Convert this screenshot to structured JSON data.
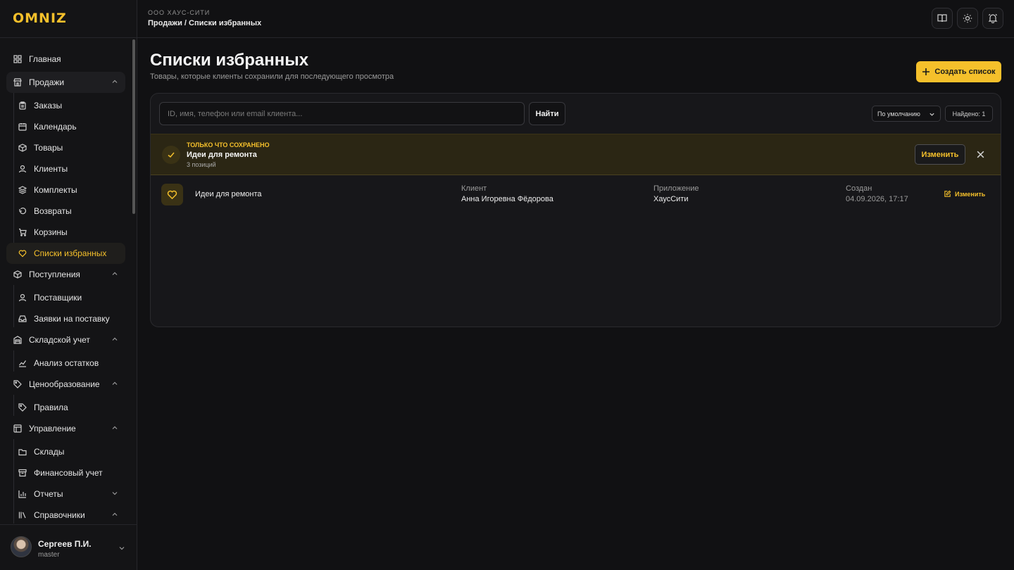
{
  "brand": {
    "logo_text": "OMNIZ",
    "accent": "#f5c02b"
  },
  "header": {
    "org": "ООО ХАУС-СИТИ",
    "breadcrumb": "Продажи / Списки избранных"
  },
  "sidebar": {
    "items": [
      {
        "label": "Главная",
        "icon": "grid-icon"
      },
      {
        "label": "Продажи",
        "icon": "store-icon",
        "expanded": true
      },
      {
        "label": "Заказы",
        "icon": "clipboard-icon"
      },
      {
        "label": "Календарь",
        "icon": "calendar-icon"
      },
      {
        "label": "Товары",
        "icon": "box-icon"
      },
      {
        "label": "Клиенты",
        "icon": "user-icon"
      },
      {
        "label": "Комплекты",
        "icon": "layers-icon"
      },
      {
        "label": "Возвраты",
        "icon": "return-icon"
      },
      {
        "label": "Корзины",
        "icon": "cart-icon"
      },
      {
        "label": "Списки избранных",
        "icon": "heart-icon",
        "active": true
      },
      {
        "label": "Поступления",
        "icon": "package-icon",
        "expanded": true
      },
      {
        "label": "Поставщики",
        "icon": "user-icon"
      },
      {
        "label": "Заявки на поставку",
        "icon": "inbox-icon"
      },
      {
        "label": "Складской учет",
        "icon": "warehouse-icon",
        "expanded": true
      },
      {
        "label": "Анализ остатков",
        "icon": "chart-line-icon"
      },
      {
        "label": "Ценообразование",
        "icon": "tag-icon",
        "expanded": true
      },
      {
        "label": "Правила",
        "icon": "tag-icon"
      },
      {
        "label": "Управление",
        "icon": "table-icon",
        "expanded": true
      },
      {
        "label": "Склады",
        "icon": "folder-icon"
      },
      {
        "label": "Финансовый учет",
        "icon": "archive-icon"
      },
      {
        "label": "Отчеты",
        "icon": "bar-chart-icon",
        "expanded": false
      },
      {
        "label": "Справочники",
        "icon": "library-icon",
        "expanded": true
      }
    ]
  },
  "user": {
    "name": "Сергеев П.И.",
    "role": "master"
  },
  "page": {
    "title": "Списки избранных",
    "subtitle": "Товары, которые клиенты сохранили для последующего просмотра",
    "create_label": "Создать список"
  },
  "toolbar": {
    "search_placeholder": "ID, имя, телефон или email клиента...",
    "find_label": "Найти",
    "sort_label": "По умолчанию",
    "found_label": "Найдено: 1"
  },
  "banner": {
    "label": "ТОЛЬКО ЧТО СОХРАНЕНО",
    "title": "Идеи для ремонта",
    "count": "3 позиций",
    "edit_label": "Изменить"
  },
  "rows": [
    {
      "name": "Идеи для ремонта",
      "client_label": "Клиент",
      "client": "Анна Игоревна Фёдорова",
      "app_label": "Приложение",
      "app": "ХаусСити",
      "created_label": "Создан",
      "created": "04.09.2026, 17:17",
      "edit_label": "Изменить"
    }
  ]
}
